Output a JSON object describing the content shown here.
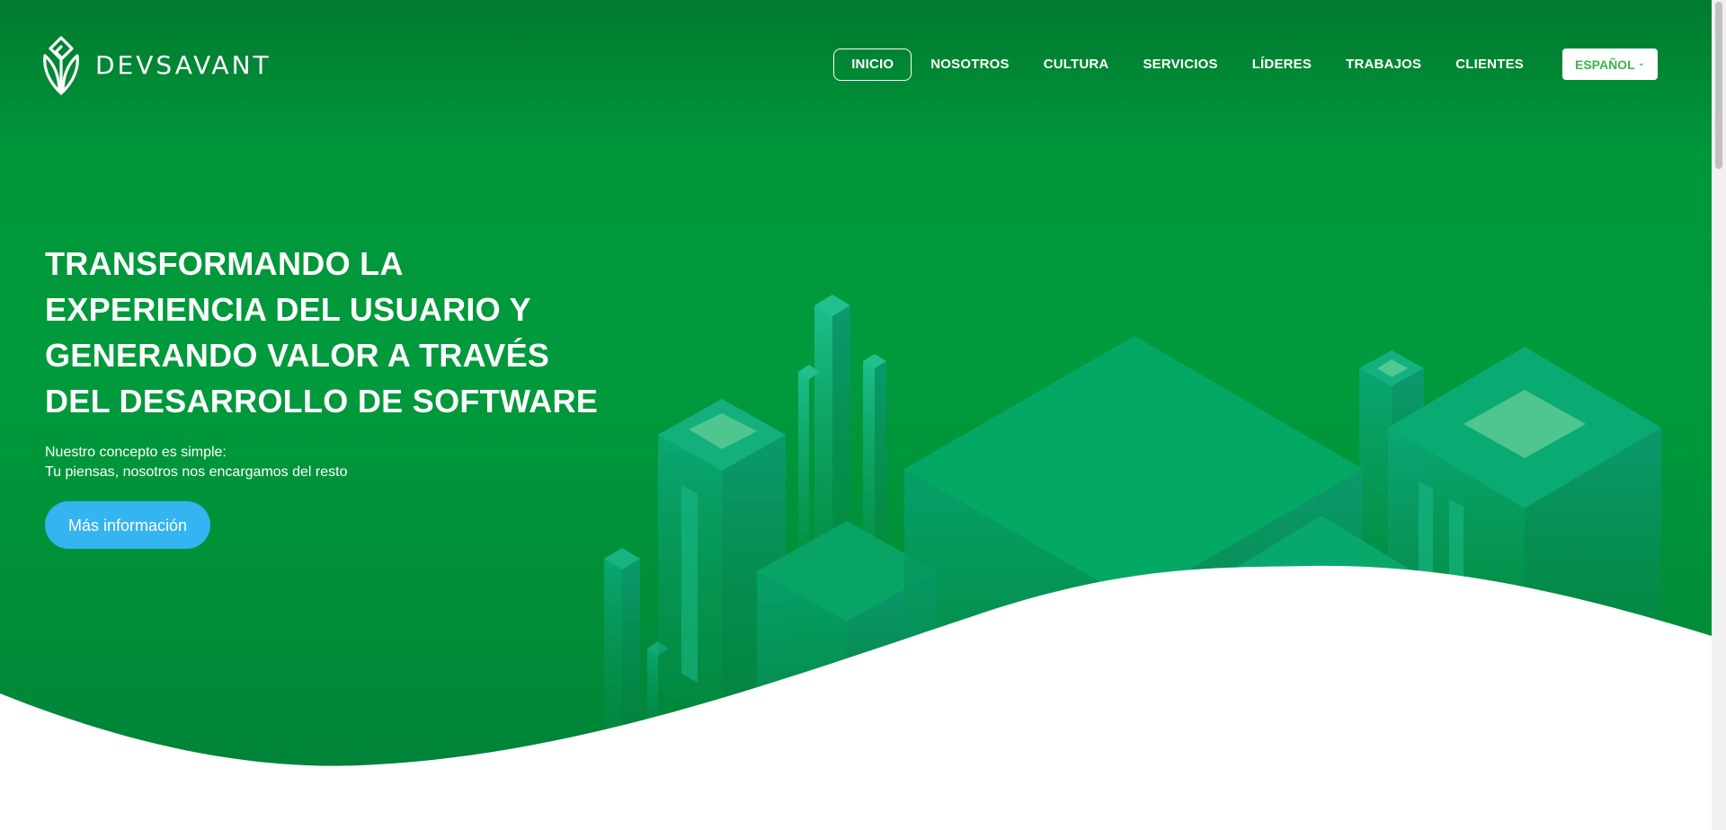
{
  "brand": {
    "name": "DEVSAVANT"
  },
  "nav": {
    "items": [
      {
        "label": "INICIO",
        "active": true
      },
      {
        "label": "NOSOTROS"
      },
      {
        "label": "CULTURA"
      },
      {
        "label": "SERVICIOS"
      },
      {
        "label": "LÍDERES"
      },
      {
        "label": "TRABAJOS"
      },
      {
        "label": "CLIENTES"
      }
    ],
    "language": {
      "label": "ESPAÑOL",
      "icon": "chevron-down-icon"
    }
  },
  "hero": {
    "title": "TRANSFORMANDO LA EXPERIENCIA DEL USUARIO Y GENERANDO VALOR A TRAVÉS DEL DESARROLLO DE SOFTWARE",
    "subtitle_line1": "Nuestro concepto es simple:",
    "subtitle_line2": "Tu piensas, nosotros nos encargamos del resto",
    "cta_label": "Más información"
  },
  "colors": {
    "hero_green": "#009a3c",
    "cta_blue": "#35b4f2",
    "language_text": "#3bb54a",
    "building_teal": "#00a86b"
  }
}
